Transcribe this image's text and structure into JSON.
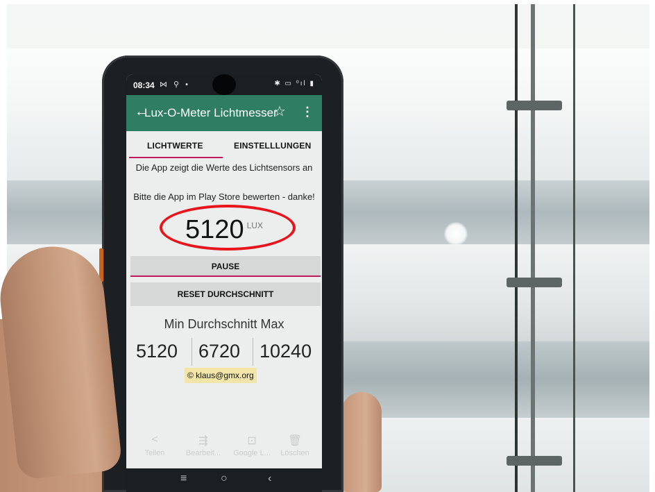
{
  "status_bar": {
    "time": "08:34",
    "left_icons": "⋈ ⚲ •",
    "right_icons": "✱ ▭ ⁰ıl ▮"
  },
  "app_bar": {
    "title": "Lux-O-Meter Lichtmesser",
    "back_icon": "←",
    "star_icon": "☆",
    "menu_icon": "⋮"
  },
  "tabs": [
    {
      "label": "LICHTWERTE",
      "selected": true
    },
    {
      "label": "EINSTELLLUNGEN",
      "selected": false
    }
  ],
  "info_text": "Die App zeigt die Werte des Lichtsensors an",
  "rating_text": "Bitte die App im Play Store bewerten - danke!",
  "reading": {
    "value": "5120",
    "unit": "LUX"
  },
  "buttons": {
    "pause": "PAUSE",
    "reset": "RESET DURCHSCHNITT"
  },
  "stats": {
    "header": "Min Durchschnitt Max",
    "min": "5120",
    "avg": "6720",
    "max": "10240"
  },
  "credit": "© klaus@gmx.org",
  "bottom_actions": [
    {
      "label": "Teilen",
      "icon": "<"
    },
    {
      "label": "Bearbeit...",
      "icon": "⇶"
    },
    {
      "label": "Google L...",
      "icon": "⊡"
    },
    {
      "label": "Löschen",
      "icon": "🗑"
    }
  ],
  "nav_bar": {
    "recents": "≡",
    "home": "○",
    "back": "‹"
  },
  "colors": {
    "app_bar": "#2f7d63",
    "accent": "#c2185b",
    "highlight_ring": "#e8151c"
  }
}
